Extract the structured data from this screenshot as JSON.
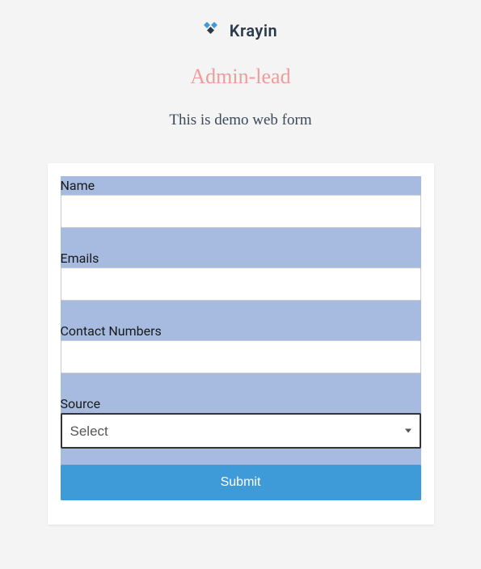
{
  "logo": {
    "brand_text": "Krayin",
    "icon_name": "krayin-diamond-icon"
  },
  "header": {
    "title": "Admin-lead",
    "description": "This is demo web form"
  },
  "form": {
    "fields": [
      {
        "label": "Name",
        "type": "text",
        "value": ""
      },
      {
        "label": "Emails",
        "type": "text",
        "value": ""
      },
      {
        "label": "Contact Numbers",
        "type": "text",
        "value": ""
      },
      {
        "label": "Source",
        "type": "select",
        "selected": "Select",
        "options": [
          "Select"
        ]
      }
    ],
    "submit_label": "Submit"
  },
  "colors": {
    "field_band": "#a6bbdf",
    "title_color": "#f19c9c",
    "button_bg": "#3f9ad8"
  }
}
